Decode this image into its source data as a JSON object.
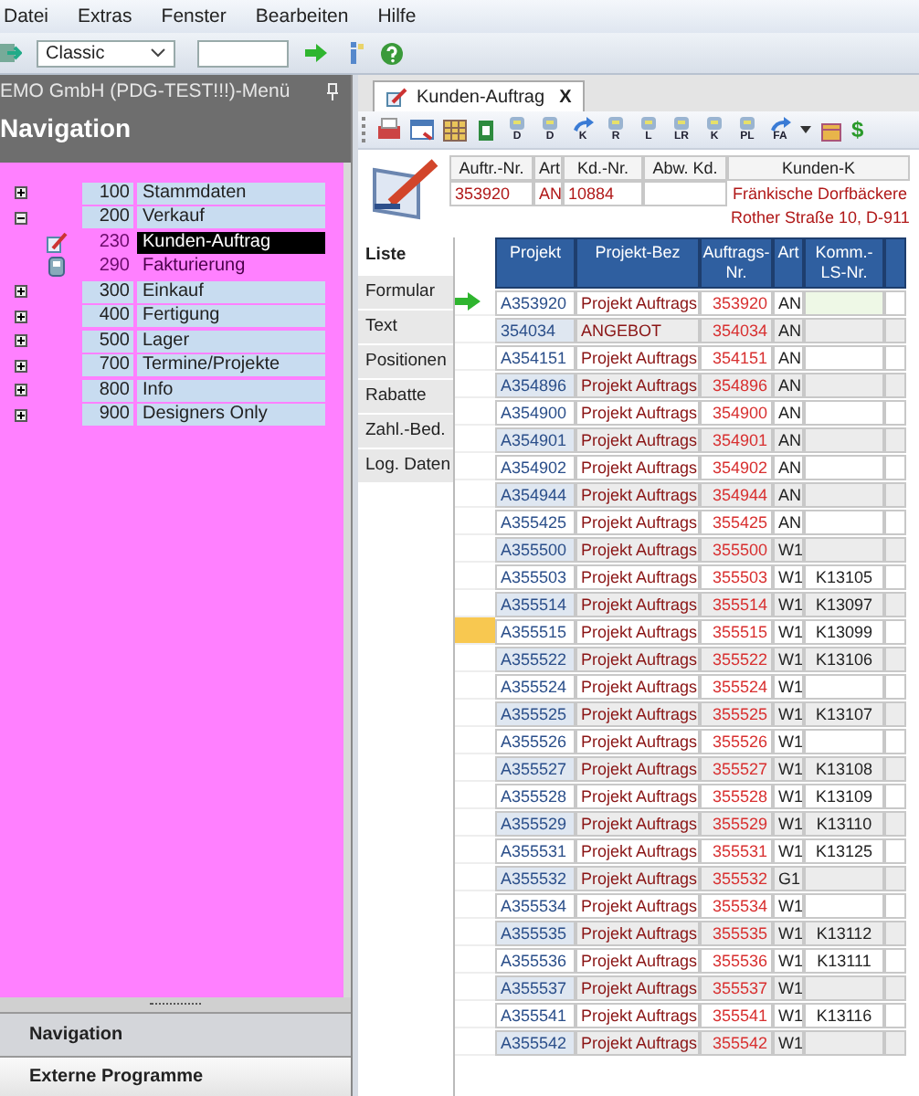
{
  "menu": [
    "Datei",
    "Extras",
    "Fenster",
    "Bearbeiten",
    "Hilfe"
  ],
  "toolbar": {
    "layout": "Classic"
  },
  "nav_panel": {
    "title": "EMO GmbH (PDG-TEST!!!)-Menü",
    "heading": "Navigation",
    "items": [
      {
        "number": "100",
        "label": "Stammdaten",
        "expanded": false
      },
      {
        "number": "200",
        "label": "Verkauf",
        "expanded": true,
        "children": [
          {
            "number": "230",
            "label": "Kunden-Auftrag",
            "selected": true,
            "kind": "order"
          },
          {
            "number": "290",
            "label": "Fakturierung",
            "selected": false,
            "kind": "invoice"
          }
        ]
      },
      {
        "number": "300",
        "label": "Einkauf",
        "expanded": false
      },
      {
        "number": "400",
        "label": "Fertigung",
        "expanded": false
      },
      {
        "number": "500",
        "label": "Lager",
        "expanded": false
      },
      {
        "number": "700",
        "label": "Termine/Projekte",
        "expanded": false
      },
      {
        "number": "800",
        "label": "Info",
        "expanded": false
      },
      {
        "number": "900",
        "label": "Designers Only",
        "expanded": false
      }
    ],
    "bottom_buttons": [
      "Navigation",
      "Externe Programme"
    ]
  },
  "document_tab": {
    "title": "Kunden-Auftrag",
    "close": "X"
  },
  "doc_toolbar": [
    {
      "kind": "icon"
    },
    {
      "kind": "icon"
    },
    {
      "kind": "icon"
    },
    {
      "kind": "icon"
    },
    {
      "kind": "lettered",
      "label": "D"
    },
    {
      "kind": "lettered",
      "label": "D"
    },
    {
      "kind": "arrow",
      "label": "K"
    },
    {
      "kind": "lettered",
      "label": "R"
    },
    {
      "kind": "lettered",
      "label": "L"
    },
    {
      "kind": "lettered",
      "label": "LR"
    },
    {
      "kind": "lettered",
      "label": "K"
    },
    {
      "kind": "lettered",
      "label": "PL"
    },
    {
      "kind": "arrow",
      "label": "FA"
    },
    {
      "kind": "caret"
    },
    {
      "kind": "icon"
    },
    {
      "kind": "glyph",
      "label": "$"
    }
  ],
  "header": {
    "fields": [
      {
        "label": "Auftr.-Nr.",
        "value": "353920"
      },
      {
        "label": "Art",
        "value": "AN"
      },
      {
        "label": "Kd.-Nr.",
        "value": "10884"
      },
      {
        "label": "Abw. Kd."
      },
      {
        "label": "Kunden-K",
        "value": "Fränkische Dorfbäckere",
        "value_2": "Rother Straße 10, D-911"
      }
    ]
  },
  "side_tabs": [
    {
      "label": "Liste",
      "selected": true
    },
    {
      "label": "Formular",
      "selected": false
    },
    {
      "label": "Text",
      "selected": false
    },
    {
      "label": "Positionen",
      "selected": false
    },
    {
      "label": "Rabatte",
      "selected": false
    },
    {
      "label": "Zahl.-Bed.",
      "selected": false
    },
    {
      "label": "Log. Daten",
      "selected": false
    }
  ],
  "table": {
    "columns": [
      "Projekt",
      "Projekt-Bez",
      "Auftrags-Nr.",
      "Art",
      "Komm.-LS-Nr."
    ],
    "rows": [
      {
        "projekt": "A353920",
        "bez": "Projekt Auftrags",
        "nr": "353920",
        "art": "AN",
        "komm": "",
        "current": true,
        "marked": false
      },
      {
        "projekt": "354034",
        "bez": "ANGEBOT",
        "nr": "354034",
        "art": "AN",
        "komm": "",
        "current": false,
        "marked": false
      },
      {
        "projekt": "A354151",
        "bez": "Projekt Auftrags",
        "nr": "354151",
        "art": "AN",
        "komm": "",
        "current": false,
        "marked": false
      },
      {
        "projekt": "A354896",
        "bez": "Projekt Auftrags",
        "nr": "354896",
        "art": "AN",
        "komm": "",
        "current": false,
        "marked": false
      },
      {
        "projekt": "A354900",
        "bez": "Projekt Auftrags",
        "nr": "354900",
        "art": "AN",
        "komm": "",
        "current": false,
        "marked": false
      },
      {
        "projekt": "A354901",
        "bez": "Projekt Auftrags",
        "nr": "354901",
        "art": "AN",
        "komm": "",
        "current": false,
        "marked": false
      },
      {
        "projekt": "A354902",
        "bez": "Projekt Auftrags",
        "nr": "354902",
        "art": "AN",
        "komm": "",
        "current": false,
        "marked": false
      },
      {
        "projekt": "A354944",
        "bez": "Projekt Auftrags",
        "nr": "354944",
        "art": "AN",
        "komm": "",
        "current": false,
        "marked": false
      },
      {
        "projekt": "A355425",
        "bez": "Projekt Auftrags",
        "nr": "355425",
        "art": "AN",
        "komm": "",
        "current": false,
        "marked": false
      },
      {
        "projekt": "A355500",
        "bez": "Projekt Auftrags",
        "nr": "355500",
        "art": "W1",
        "komm": "",
        "current": false,
        "marked": false
      },
      {
        "projekt": "A355503",
        "bez": "Projekt Auftrags",
        "nr": "355503",
        "art": "W1",
        "komm": "K13105",
        "current": false,
        "marked": false
      },
      {
        "projekt": "A355514",
        "bez": "Projekt Auftrags",
        "nr": "355514",
        "art": "W1",
        "komm": "K13097",
        "current": false,
        "marked": false
      },
      {
        "projekt": "A355515",
        "bez": "Projekt Auftrags",
        "nr": "355515",
        "art": "W1",
        "komm": "K13099",
        "current": false,
        "marked": true
      },
      {
        "projekt": "A355522",
        "bez": "Projekt Auftrags",
        "nr": "355522",
        "art": "W1",
        "komm": "K13106",
        "current": false,
        "marked": false
      },
      {
        "projekt": "A355524",
        "bez": "Projekt Auftrags",
        "nr": "355524",
        "art": "W1",
        "komm": "",
        "current": false,
        "marked": false
      },
      {
        "projekt": "A355525",
        "bez": "Projekt Auftrags",
        "nr": "355525",
        "art": "W1",
        "komm": "K13107",
        "current": false,
        "marked": false
      },
      {
        "projekt": "A355526",
        "bez": "Projekt Auftrags",
        "nr": "355526",
        "art": "W1",
        "komm": "",
        "current": false,
        "marked": false
      },
      {
        "projekt": "A355527",
        "bez": "Projekt Auftrags",
        "nr": "355527",
        "art": "W1",
        "komm": "K13108",
        "current": false,
        "marked": false
      },
      {
        "projekt": "A355528",
        "bez": "Projekt Auftrags",
        "nr": "355528",
        "art": "W1",
        "komm": "K13109",
        "current": false,
        "marked": false
      },
      {
        "projekt": "A355529",
        "bez": "Projekt Auftrags",
        "nr": "355529",
        "art": "W1",
        "komm": "K13110",
        "current": false,
        "marked": false
      },
      {
        "projekt": "A355531",
        "bez": "Projekt Auftrags",
        "nr": "355531",
        "art": "W1",
        "komm": "K13125",
        "current": false,
        "marked": false
      },
      {
        "projekt": "A355532",
        "bez": "Projekt Auftrags",
        "nr": "355532",
        "art": "G1",
        "komm": "",
        "current": false,
        "marked": false
      },
      {
        "projekt": "A355534",
        "bez": "Projekt Auftrags",
        "nr": "355534",
        "art": "W1",
        "komm": "",
        "current": false,
        "marked": false
      },
      {
        "projekt": "A355535",
        "bez": "Projekt Auftrags",
        "nr": "355535",
        "art": "W1",
        "komm": "K13112",
        "current": false,
        "marked": false
      },
      {
        "projekt": "A355536",
        "bez": "Projekt Auftrags",
        "nr": "355536",
        "art": "W1",
        "komm": "K13111",
        "current": false,
        "marked": false
      },
      {
        "projekt": "A355537",
        "bez": "Projekt Auftrags",
        "nr": "355537",
        "art": "W1",
        "komm": "",
        "current": false,
        "marked": false
      },
      {
        "projekt": "A355541",
        "bez": "Projekt Auftrags",
        "nr": "355541",
        "art": "W1",
        "komm": "K13116",
        "current": false,
        "marked": false
      },
      {
        "projekt": "A355542",
        "bez": "Projekt Auftrags",
        "nr": "355542",
        "art": "W1",
        "komm": "",
        "current": false,
        "marked": false
      }
    ]
  }
}
